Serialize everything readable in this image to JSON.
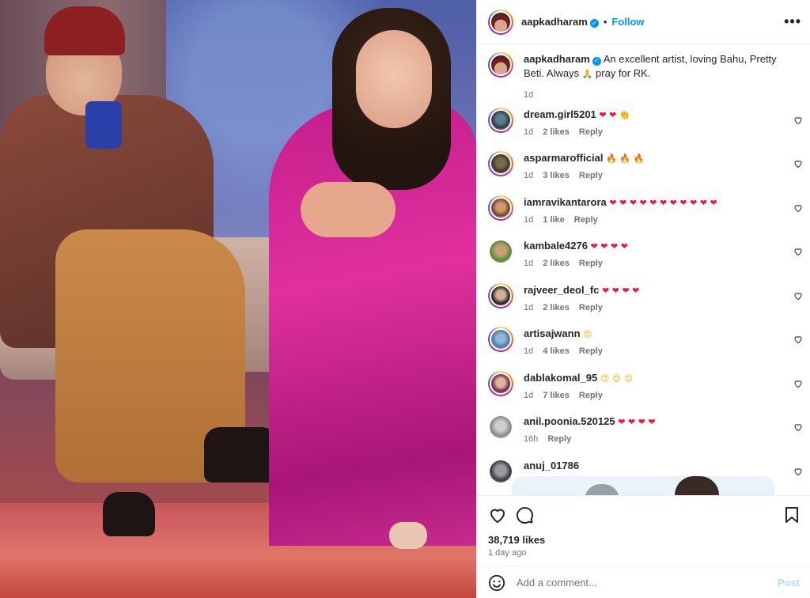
{
  "header": {
    "username": "aapkadharam",
    "separator": "•",
    "follow_label": "Follow",
    "more_label": "•••"
  },
  "caption": {
    "username": "aapkadharam",
    "text_before_emoji": " An excellent artist, loving Bahu, Pretty Beti. Always ",
    "emoji": "🙏",
    "text_after_emoji": " pray for RK.",
    "time": "1d"
  },
  "comments": [
    {
      "username": "dream.girl5201",
      "emojis": "❤ ❤ 👏",
      "time": "1d",
      "likes": "2 likes",
      "reply": "Reply"
    },
    {
      "username": "asparmarofficial",
      "emojis": "🔥 🔥 🔥",
      "time": "1d",
      "likes": "3 likes",
      "reply": "Reply"
    },
    {
      "username": "iamravikantarora",
      "emojis": "❤ ❤ ❤ ❤ ❤ ❤ ❤ ❤ ❤ ❤ ❤",
      "time": "1d",
      "likes": "1 like",
      "reply": "Reply"
    },
    {
      "username": "kambale4276",
      "emojis": "❤ ❤ ❤ ❤",
      "time": "1d",
      "likes": "2 likes",
      "reply": "Reply"
    },
    {
      "username": "rajveer_deol_fc",
      "emojis": "❤ ❤ ❤ ❤",
      "time": "1d",
      "likes": "2 likes",
      "reply": "Reply"
    },
    {
      "username": "artisajwann",
      "emojis": "😍",
      "time": "1d",
      "likes": "4 likes",
      "reply": "Reply"
    },
    {
      "username": "dablakomal_95",
      "emojis": "😍 😍 😍",
      "time": "1d",
      "likes": "7 likes",
      "reply": "Reply"
    },
    {
      "username": "anil.poonia.520125",
      "emojis": "❤ ❤ ❤ ❤",
      "time": "16h",
      "likes": "",
      "reply": "Reply"
    },
    {
      "username": "anuj_01786",
      "emojis": "",
      "time": "",
      "likes": "",
      "reply": ""
    }
  ],
  "footer": {
    "likes": "38,719 likes",
    "ago": "1 day ago",
    "comment_placeholder": "Add a comment...",
    "post_label": "Post"
  },
  "colors": {
    "link_blue": "#0095f6",
    "post_disabled": "#b2dffc",
    "muted": "#737373",
    "text": "#262626"
  },
  "icons": {
    "like": "heart-outline-icon",
    "comment": "comment-bubble-icon",
    "save": "bookmark-icon",
    "emoji": "smiley-icon",
    "verified": "verified-badge-icon",
    "comment_like": "heart-outline-icon"
  }
}
